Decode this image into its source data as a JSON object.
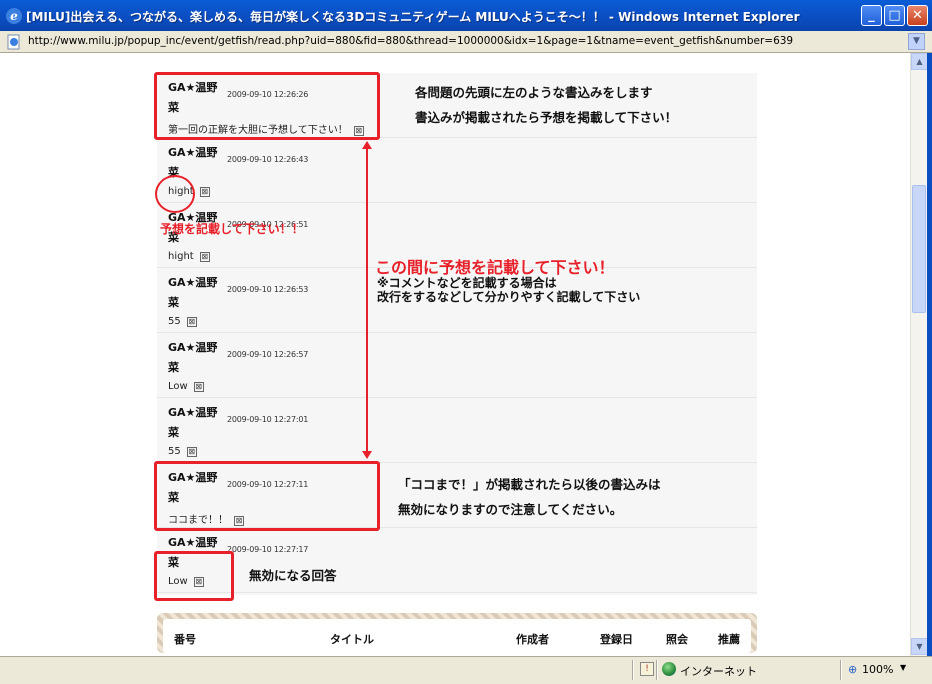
{
  "window": {
    "title": "[MILU]出会える、つながる、楽しめる、毎日が楽しくなる3Dコミュニティゲーム MILUへようこそ～！！ - Windows Internet Explorer",
    "address": "http://www.milu.jp/popup_inc/event/getfish/read.php?uid=880&fid=880&thread=1000000&idx=1&page=1&tname=event_getfish&number=639"
  },
  "posts": [
    {
      "author": "GA★温野菜",
      "date": "2009-09-10 12:26:26",
      "body": "第一回の正解を大胆に予想して下さい！"
    },
    {
      "author": "GA★温野菜",
      "date": "2009-09-10 12:26:43",
      "body": "hight"
    },
    {
      "author": "GA★温野菜",
      "date": "2009-09-10 12:26:51",
      "body": "hight"
    },
    {
      "author": "GA★温野菜",
      "date": "2009-09-10 12:26:53",
      "body": "55"
    },
    {
      "author": "GA★温野菜",
      "date": "2009-09-10 12:26:57",
      "body": "Low"
    },
    {
      "author": "GA★温野菜",
      "date": "2009-09-10 12:27:01",
      "body": "55"
    },
    {
      "author": "GA★温野菜",
      "date": "2009-09-10 12:27:11",
      "body": "ココまで！！"
    },
    {
      "author": "GA★温野菜",
      "date": "2009-09-10 12:27:17",
      "body": "Low"
    }
  ],
  "delete_glyph": "⊠",
  "annotations": {
    "top_note_1": "各問題の先頭に左のような書込みをします",
    "top_note_2": "書込みが掲載されたら予想を掲載して下さい！",
    "left_note": "予想を記載して下さい！！",
    "middle_title": "この間に予想を記載して下さい！",
    "middle_sub_1": "※コメントなどを記載する場合は",
    "middle_sub_2": "改行をするなどして分かりやすく記載して下さい",
    "bottom_note_1": "「ココまで！」が掲載されたら以後の書込みは",
    "bottom_note_2": "無効になりますので注意してください。",
    "invalid_note": "無効になる回答"
  },
  "list_header": [
    "番号",
    "タイトル",
    "作成者",
    "登録日",
    "照会",
    "推薦"
  ],
  "status": {
    "zone": "インターネット",
    "zoom": "100%"
  },
  "colors": {
    "annotation_red": "#e8202a",
    "titlebar_blue": "#0b4ec2"
  }
}
